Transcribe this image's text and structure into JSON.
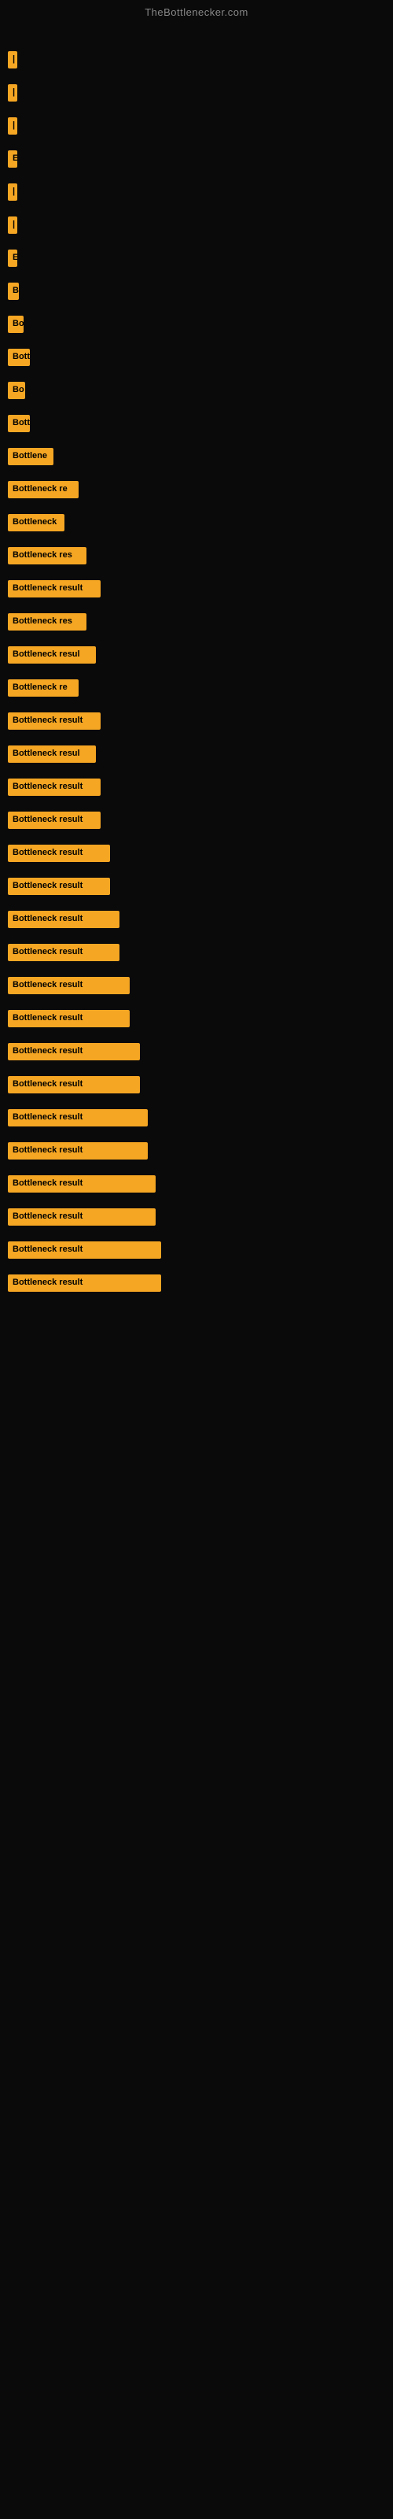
{
  "site_title": "TheBottlenecker.com",
  "bars": [
    {
      "label": "|",
      "width": 4
    },
    {
      "label": "|",
      "width": 4
    },
    {
      "label": "|",
      "width": 4
    },
    {
      "label": "E",
      "width": 10
    },
    {
      "label": "|",
      "width": 4
    },
    {
      "label": "|",
      "width": 4
    },
    {
      "label": "E",
      "width": 10
    },
    {
      "label": "B",
      "width": 14
    },
    {
      "label": "Bo",
      "width": 20
    },
    {
      "label": "Bott",
      "width": 28
    },
    {
      "label": "Bo",
      "width": 22
    },
    {
      "label": "Bott",
      "width": 28
    },
    {
      "label": "Bottlene",
      "width": 58
    },
    {
      "label": "Bottleneck re",
      "width": 90
    },
    {
      "label": "Bottleneck",
      "width": 72
    },
    {
      "label": "Bottleneck res",
      "width": 100
    },
    {
      "label": "Bottleneck result",
      "width": 118
    },
    {
      "label": "Bottleneck res",
      "width": 100
    },
    {
      "label": "Bottleneck resul",
      "width": 112
    },
    {
      "label": "Bottleneck re",
      "width": 90
    },
    {
      "label": "Bottleneck result",
      "width": 118
    },
    {
      "label": "Bottleneck resul",
      "width": 112
    },
    {
      "label": "Bottleneck result",
      "width": 118
    },
    {
      "label": "Bottleneck result",
      "width": 118
    },
    {
      "label": "Bottleneck result",
      "width": 130
    },
    {
      "label": "Bottleneck result",
      "width": 130
    },
    {
      "label": "Bottleneck result",
      "width": 142
    },
    {
      "label": "Bottleneck result",
      "width": 142
    },
    {
      "label": "Bottleneck result",
      "width": 155
    },
    {
      "label": "Bottleneck result",
      "width": 155
    },
    {
      "label": "Bottleneck result",
      "width": 168
    },
    {
      "label": "Bottleneck result",
      "width": 168
    },
    {
      "label": "Bottleneck result",
      "width": 178
    },
    {
      "label": "Bottleneck result",
      "width": 178
    },
    {
      "label": "Bottleneck result",
      "width": 188
    },
    {
      "label": "Bottleneck result",
      "width": 188
    },
    {
      "label": "Bottleneck result",
      "width": 195
    },
    {
      "label": "Bottleneck result",
      "width": 195
    }
  ]
}
